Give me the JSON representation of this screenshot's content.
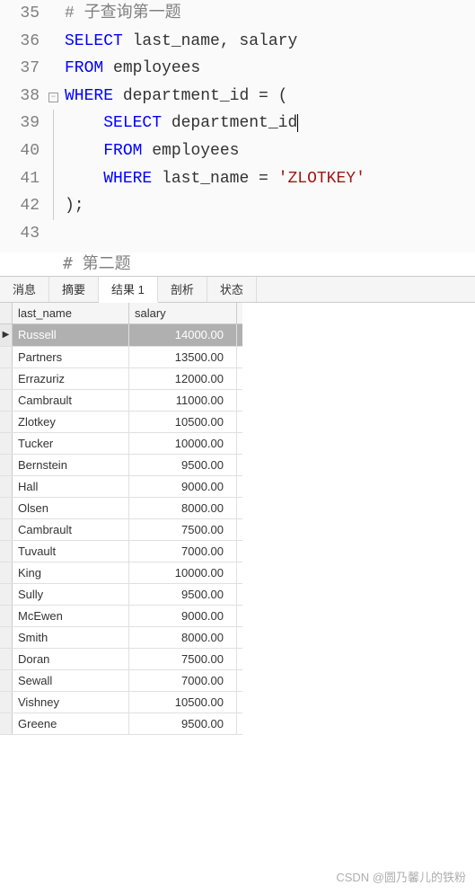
{
  "editor": {
    "lines": [
      {
        "num": 35,
        "fold": "",
        "tokens": [
          {
            "t": "comment",
            "v": "# 子查询第一题"
          }
        ]
      },
      {
        "num": 36,
        "fold": "",
        "tokens": [
          {
            "t": "kw",
            "v": "SELECT"
          },
          {
            "t": "ident",
            "v": " last_name, salary"
          }
        ]
      },
      {
        "num": 37,
        "fold": "",
        "tokens": [
          {
            "t": "kw",
            "v": "FROM"
          },
          {
            "t": "ident",
            "v": " employees"
          }
        ]
      },
      {
        "num": 38,
        "fold": "box",
        "tokens": [
          {
            "t": "kw",
            "v": "WHERE"
          },
          {
            "t": "ident",
            "v": " department_id = ("
          }
        ]
      },
      {
        "num": 39,
        "fold": "line",
        "tokens": [
          {
            "t": "ident",
            "v": "    "
          },
          {
            "t": "kw",
            "v": "SELECT"
          },
          {
            "t": "ident",
            "v": " department_id"
          },
          {
            "t": "cursor",
            "v": ""
          }
        ]
      },
      {
        "num": 40,
        "fold": "line",
        "tokens": [
          {
            "t": "ident",
            "v": "    "
          },
          {
            "t": "kw",
            "v": "FROM"
          },
          {
            "t": "ident",
            "v": " employees"
          }
        ]
      },
      {
        "num": 41,
        "fold": "line",
        "tokens": [
          {
            "t": "ident",
            "v": "    "
          },
          {
            "t": "kw",
            "v": "WHERE"
          },
          {
            "t": "ident",
            "v": " last_name = "
          },
          {
            "t": "str",
            "v": "'ZLOTKEY'"
          }
        ]
      },
      {
        "num": 42,
        "fold": "end",
        "tokens": [
          {
            "t": "ident",
            "v": ");"
          }
        ]
      },
      {
        "num": 43,
        "fold": "",
        "tokens": []
      }
    ],
    "truncated": "# 第二题"
  },
  "tabs": {
    "items": [
      "消息",
      "摘要",
      "结果 1",
      "剖析",
      "状态"
    ],
    "active": 2
  },
  "results": {
    "columns": [
      "last_name",
      "salary"
    ],
    "rows": [
      {
        "last_name": "Russell",
        "salary": "14000.00",
        "selected": true,
        "marker": "▶"
      },
      {
        "last_name": "Partners",
        "salary": "13500.00"
      },
      {
        "last_name": "Errazuriz",
        "salary": "12000.00"
      },
      {
        "last_name": "Cambrault",
        "salary": "11000.00"
      },
      {
        "last_name": "Zlotkey",
        "salary": "10500.00"
      },
      {
        "last_name": "Tucker",
        "salary": "10000.00"
      },
      {
        "last_name": "Bernstein",
        "salary": "9500.00"
      },
      {
        "last_name": "Hall",
        "salary": "9000.00"
      },
      {
        "last_name": "Olsen",
        "salary": "8000.00"
      },
      {
        "last_name": "Cambrault",
        "salary": "7500.00"
      },
      {
        "last_name": "Tuvault",
        "salary": "7000.00"
      },
      {
        "last_name": "King",
        "salary": "10000.00"
      },
      {
        "last_name": "Sully",
        "salary": "9500.00"
      },
      {
        "last_name": "McEwen",
        "salary": "9000.00"
      },
      {
        "last_name": "Smith",
        "salary": "8000.00"
      },
      {
        "last_name": "Doran",
        "salary": "7500.00"
      },
      {
        "last_name": "Sewall",
        "salary": "7000.00"
      },
      {
        "last_name": "Vishney",
        "salary": "10500.00"
      },
      {
        "last_name": "Greene",
        "salary": "9500.00"
      }
    ]
  },
  "watermark": "CSDN @圆乃馨儿的铁粉"
}
